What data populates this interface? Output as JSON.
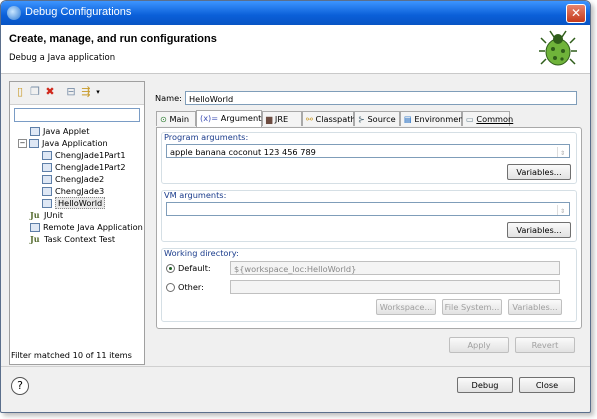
{
  "window": {
    "title": "Debug Configurations",
    "close_label": "✕"
  },
  "header": {
    "title": "Create, manage, and run configurations",
    "subtitle": "Debug a Java application"
  },
  "left_panel": {
    "filter_value": "",
    "tree": [
      {
        "label": "Java Applet",
        "level": 1
      },
      {
        "label": "Java Application",
        "level": 1,
        "expanded": true
      },
      {
        "label": "ChengJade1Part1",
        "level": 2
      },
      {
        "label": "ChengJade1Part2",
        "level": 2
      },
      {
        "label": "ChengJade2",
        "level": 2
      },
      {
        "label": "ChengJade3",
        "level": 2
      },
      {
        "label": "HelloWorld",
        "level": 2,
        "selected": true
      },
      {
        "label": "JUnit",
        "level": 1
      },
      {
        "label": "Remote Java Application",
        "level": 1
      },
      {
        "label": "Task Context Test",
        "level": 1
      }
    ],
    "status": "Filter matched 10 of 11 items"
  },
  "right_panel": {
    "name_label": "Name:",
    "name_value": "HelloWorld",
    "tabs": [
      "Main",
      "Arguments",
      "JRE",
      "Classpath",
      "Source",
      "Environment",
      "Common"
    ],
    "active_tab": "Arguments",
    "program_args": {
      "label": "Program arguments:",
      "value": "apple banana coconut 123 456 789",
      "variables_button": "Variables..."
    },
    "vm_args": {
      "label": "VM arguments:",
      "value": "",
      "variables_button": "Variables..."
    },
    "working_dir": {
      "label": "Working directory:",
      "default_label": "Default:",
      "default_value": "${workspace_loc:HelloWorld}",
      "other_label": "Other:",
      "other_value": "",
      "workspace_button": "Workspace...",
      "filesystem_button": "File System...",
      "variables_button": "Variables..."
    },
    "apply_button": "Apply",
    "revert_button": "Revert"
  },
  "footer": {
    "help": "?",
    "debug_button": "Debug",
    "close_button": "Close"
  }
}
